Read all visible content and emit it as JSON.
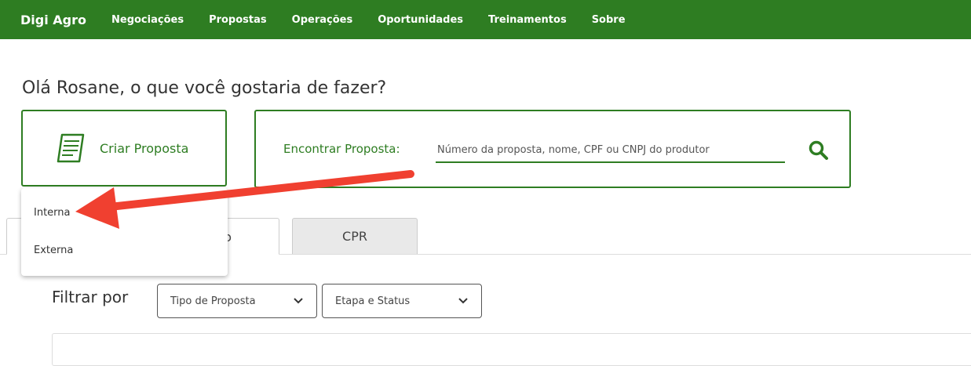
{
  "nav": {
    "brand": "Digi Agro",
    "items": [
      "Negociações",
      "Propostas",
      "Operações",
      "Oportunidades",
      "Treinamentos",
      "Sobre"
    ]
  },
  "greeting": "Olá Rosane, o que você gostaria de fazer?",
  "create": {
    "label": "Criar Proposta",
    "icon": "document-icon"
  },
  "find": {
    "label": "Encontrar Proposta:",
    "placeholder": "Número da proposta, nome, CPF ou CNPJ do produtor",
    "icon": "search-icon"
  },
  "tabs": {
    "left_partial": "ento",
    "cpr": "CPR"
  },
  "filter": {
    "label": "Filtrar por",
    "type_select": "Tipo de Proposta",
    "stage_select": "Etapa e Status"
  },
  "dropdown": {
    "items": [
      "Interna",
      "Externa"
    ]
  },
  "colors": {
    "brand_green": "#2e7d22",
    "annotation_arrow": "#f04030"
  }
}
